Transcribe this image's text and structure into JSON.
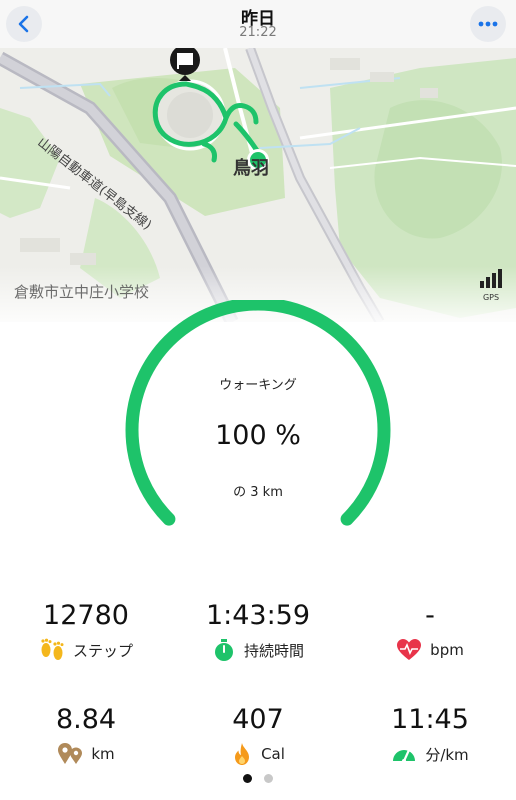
{
  "header": {
    "title": "昨日",
    "time": "21:22"
  },
  "map": {
    "road_label": "山陽自動車道(早島支線)",
    "town_label": "鳥羽",
    "school_label": "倉敷市立中庄小学校",
    "gps_label": "GPS"
  },
  "gauge": {
    "activity": "ウォーキング",
    "percent": "100 %",
    "goal": "の 3 km",
    "progress_fraction": 1.0,
    "color": "#1ec36a"
  },
  "stats": [
    {
      "value": "12780",
      "label": "ステップ",
      "icon": "footprints-icon"
    },
    {
      "value": "1:43:59",
      "label": "持続時間",
      "icon": "stopwatch-icon"
    },
    {
      "value": "-",
      "label": "bpm",
      "icon": "heart-rate-icon"
    },
    {
      "value": "8.84",
      "label": "km",
      "icon": "location-pins-icon"
    },
    {
      "value": "407",
      "label": "Cal",
      "icon": "flame-icon"
    },
    {
      "value": "11:45",
      "label": "分/km",
      "icon": "speedometer-icon"
    }
  ],
  "pager": {
    "count": 2,
    "active": 0
  },
  "colors": {
    "accent_blue": "#1a73e8",
    "route_green": "#1ec36a",
    "heart_red": "#e8344a",
    "pin_brown": "#b08a5a",
    "flame_orange": "#f59a1b"
  }
}
